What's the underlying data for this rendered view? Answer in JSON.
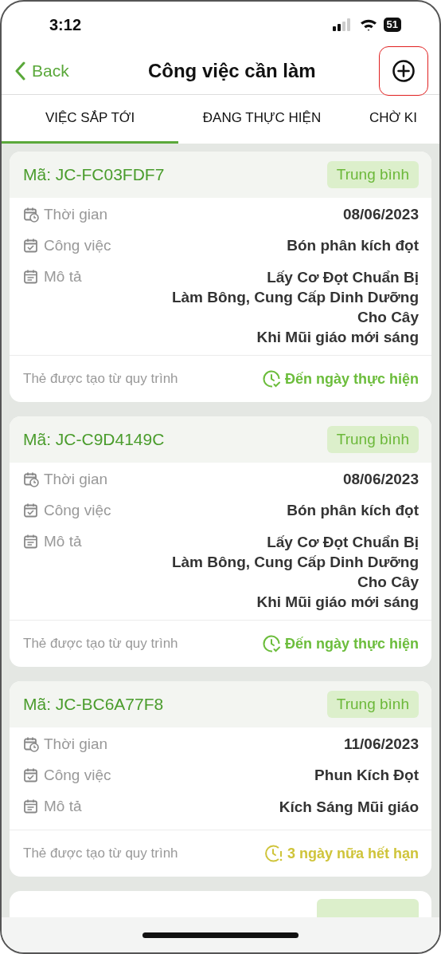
{
  "status_bar": {
    "time": "3:12",
    "battery": "51"
  },
  "nav": {
    "back": "Back",
    "title": "Công việc cần làm"
  },
  "tabs": [
    {
      "label": "VIỆC SẮP TỚI",
      "selected": true
    },
    {
      "label": "ĐANG THỰC HIỆN",
      "selected": false
    },
    {
      "label": "CHỜ KI",
      "selected": false
    }
  ],
  "cards": [
    {
      "code": "Mã: JC-FC03FDF7",
      "priority": "Trung bình",
      "time_label": "Thời gian",
      "time": "08/06/2023",
      "task_label": "Công việc",
      "task": "Bón phân kích đọt",
      "desc_label": "Mô tả",
      "desc": [
        "Lấy Cơ Đọt Chuẩn Bị",
        "Làm Bông, Cung Cấp Dinh Dưỡng",
        "Cho Cây",
        "Khi Mũi giáo mới sáng"
      ],
      "source": "Thẻ được tạo từ quy trình",
      "status": {
        "kind": "due",
        "text": "Đến ngày thực hiện"
      }
    },
    {
      "code": "Mã: JC-C9D4149C",
      "priority": "Trung bình",
      "time_label": "Thời gian",
      "time": "08/06/2023",
      "task_label": "Công việc",
      "task": "Bón phân kích đọt",
      "desc_label": "Mô tả",
      "desc": [
        "Lấy Cơ Đọt Chuẩn Bị",
        "Làm Bông, Cung Cấp Dinh Dưỡng",
        "Cho Cây",
        "Khi Mũi giáo mới sáng"
      ],
      "source": "Thẻ được tạo từ quy trình",
      "status": {
        "kind": "due",
        "text": "Đến ngày thực hiện"
      }
    },
    {
      "code": "Mã: JC-BC6A77F8",
      "priority": "Trung bình",
      "time_label": "Thời gian",
      "time": "11/06/2023",
      "task_label": "Công việc",
      "task": "Phun Kích Đọt",
      "desc_label": "Mô tả",
      "desc": [
        "Kích Sáng Mũi giáo"
      ],
      "source": "Thẻ được tạo từ quy trình",
      "status": {
        "kind": "expiring",
        "text": "3 ngày nữa hết hạn"
      }
    }
  ]
}
